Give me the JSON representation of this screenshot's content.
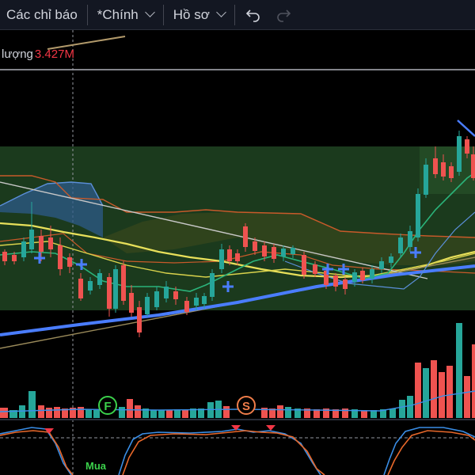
{
  "toolbar": {
    "indicators_label": "Các chỉ báo",
    "layout_label": "*Chính",
    "profile_label": "Hồ sơ",
    "undo_icon": "undo-icon",
    "redo_icon": "redo-icon"
  },
  "legend": {
    "name": "lượng",
    "value": "3.427M"
  },
  "markers": {
    "f": "F",
    "s": "S",
    "buy": "Mua"
  },
  "colors": {
    "bull": "#26a69a",
    "bear": "#ef5350",
    "volume_bull": "#26a69a",
    "volume_bear": "#ef5350",
    "cloud_green": "#1b3a1d",
    "trendline_blue": "#4a7dff",
    "stoch_k": "#3a8ee6",
    "stoch_d": "#e8682a"
  }
}
